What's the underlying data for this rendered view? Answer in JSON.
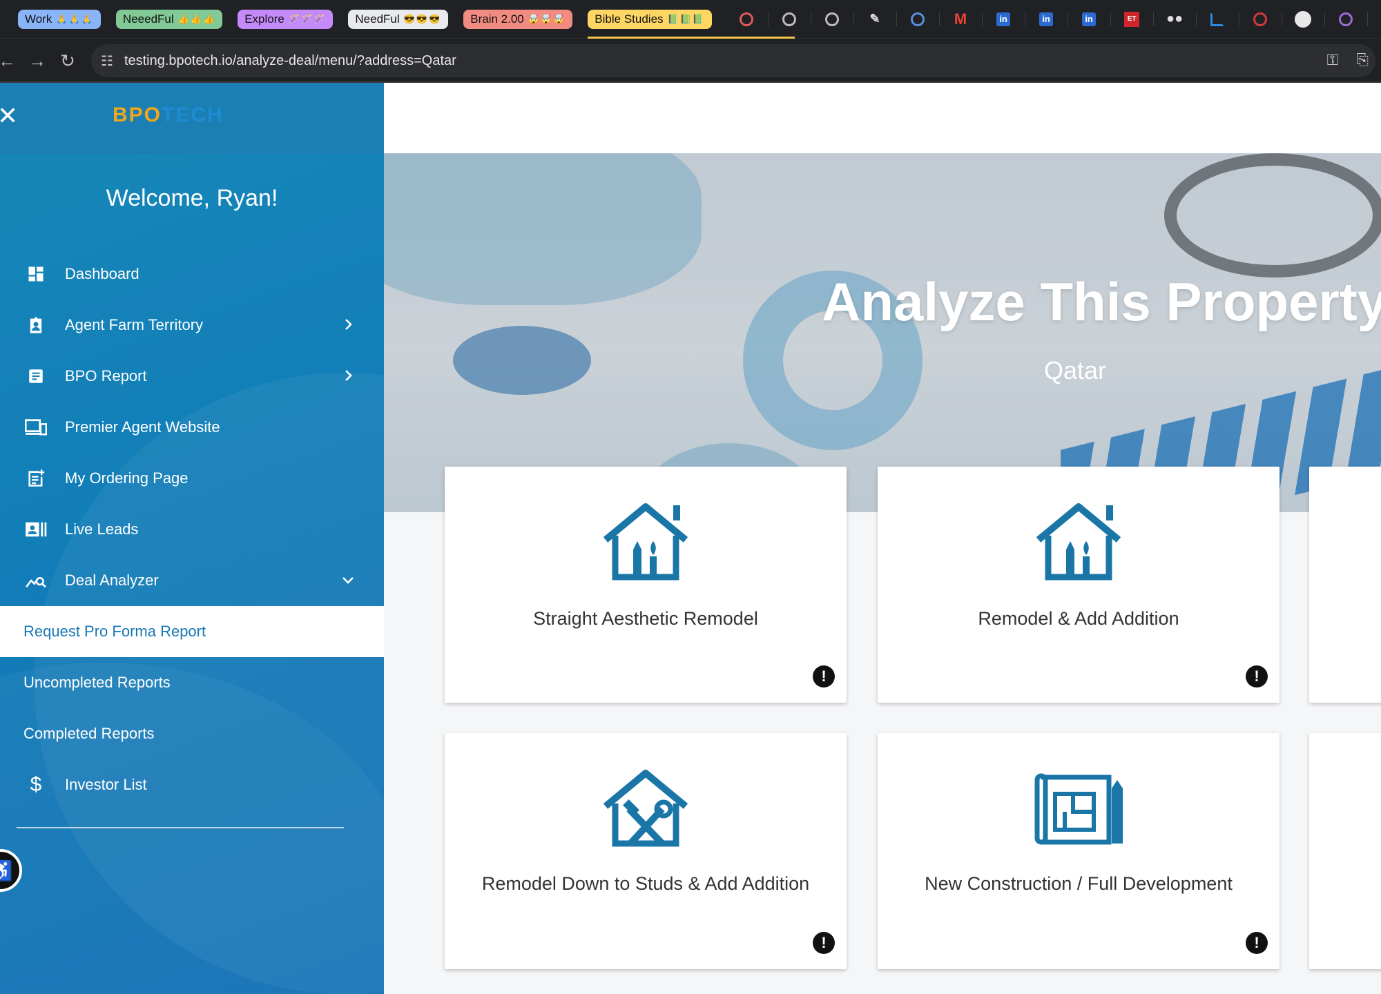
{
  "browser": {
    "bookmarks": [
      {
        "label": "Work",
        "emoji": "🙏🙏🙏",
        "color": "#8ab4f8"
      },
      {
        "label": "NeeedFul",
        "emoji": "👍👍👍",
        "color": "#81c995"
      },
      {
        "label": "Explore",
        "emoji": "🪄🪄🪄",
        "color": "#c58af9"
      },
      {
        "label": "NeedFul",
        "emoji": "😎😎😎",
        "color": "#e8eaed"
      },
      {
        "label": "Brain 2.00",
        "emoji": "🤯🤯🤯",
        "color": "#f28b82"
      },
      {
        "label": "Bible Studies",
        "emoji": "📗📗📗",
        "color": "#fdd663"
      }
    ],
    "url": "testing.bpotech.io/analyze-deal/menu/?address=Qatar"
  },
  "sidebar": {
    "logo_part1": "BPO",
    "logo_part2": "TECH",
    "welcome": "Welcome, Ryan!",
    "items": [
      {
        "label": "Dashboard"
      },
      {
        "label": "Agent Farm Territory"
      },
      {
        "label": "BPO Report"
      },
      {
        "label": "Premier Agent Website"
      },
      {
        "label": "My Ordering Page"
      },
      {
        "label": "Live Leads"
      },
      {
        "label": "Deal Analyzer"
      }
    ],
    "subitems": [
      {
        "label": "Request Pro Forma Report"
      },
      {
        "label": "Uncompleted Reports"
      },
      {
        "label": "Completed Reports"
      }
    ],
    "investor": {
      "label": "Investor List"
    }
  },
  "hero": {
    "title": "Analyze This Property",
    "subtitle": "Qatar"
  },
  "cards": [
    {
      "title": "Straight Aesthetic Remodel",
      "icon": "house-brush-icon"
    },
    {
      "title": "Remodel & Add Addition",
      "icon": "house-brush-icon"
    },
    {
      "title": "Remodel Down to Studs & Add Addition",
      "icon": "house-tools-icon"
    },
    {
      "title": "New Construction / Full Development",
      "icon": "blueprint-icon"
    }
  ],
  "colors": {
    "sidebar": "#1680b8",
    "accent": "#1a77b5",
    "logo_orange": "#f2a71a"
  }
}
